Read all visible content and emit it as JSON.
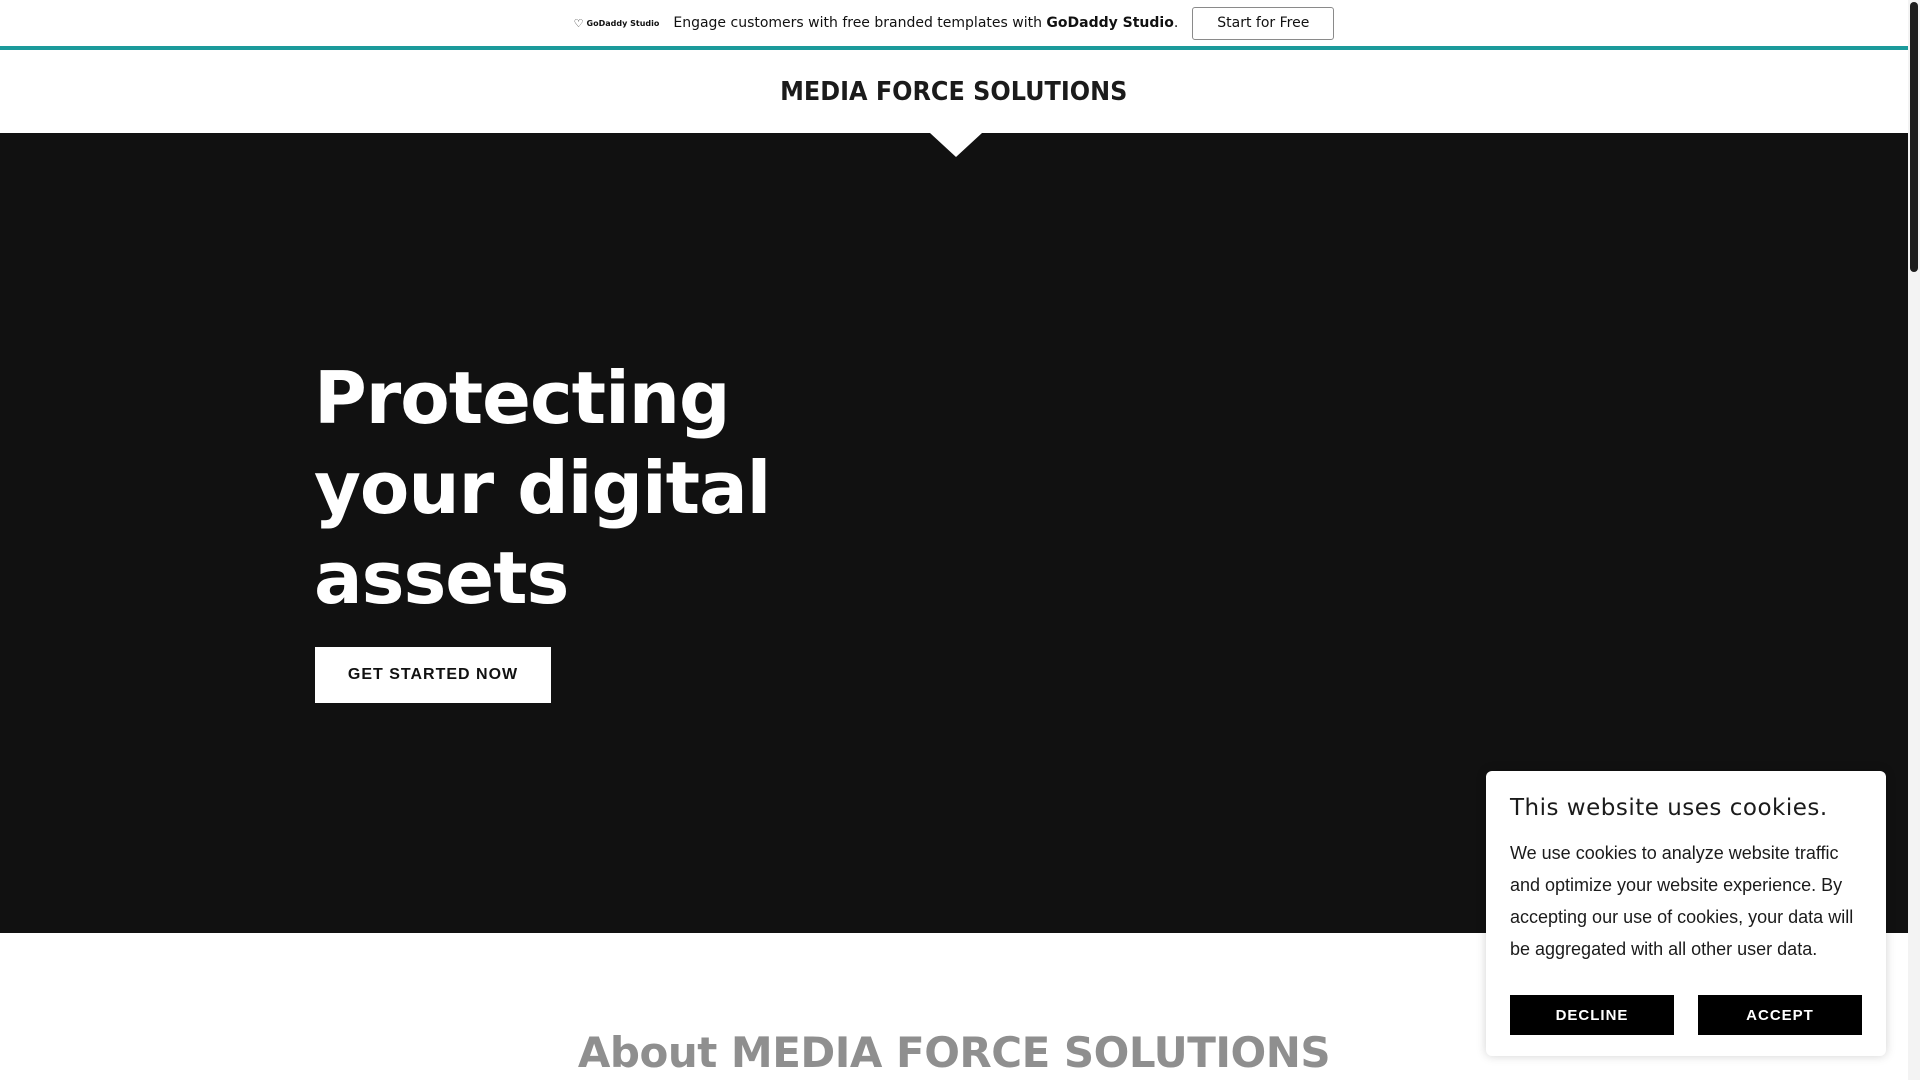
{
  "promo": {
    "logo_text": "GoDaddy Studio",
    "message_prefix": "Engage customers with free branded templates with ",
    "message_brand": "GoDaddy Studio",
    "message_suffix": ".",
    "cta_label": "Start for Free"
  },
  "header": {
    "brand": "MEDIA FORCE SOLUTIONS"
  },
  "hero": {
    "title": "Protecting your digital assets",
    "cta_label": "GET STARTED NOW"
  },
  "about": {
    "title": "About MEDIA FORCE SOLUTIONS"
  },
  "cookie": {
    "title": "This website uses cookies.",
    "body": "We use cookies to analyze website traffic and optimize your website experience. By accepting our use of cookies, your data will be aggregated with all other user data.",
    "decline_label": "DECLINE",
    "accept_label": "ACCEPT"
  },
  "colors": {
    "accent_line": "#1b9a9b",
    "hero_bg": "#111111",
    "about_title": "#8f8f8f"
  }
}
